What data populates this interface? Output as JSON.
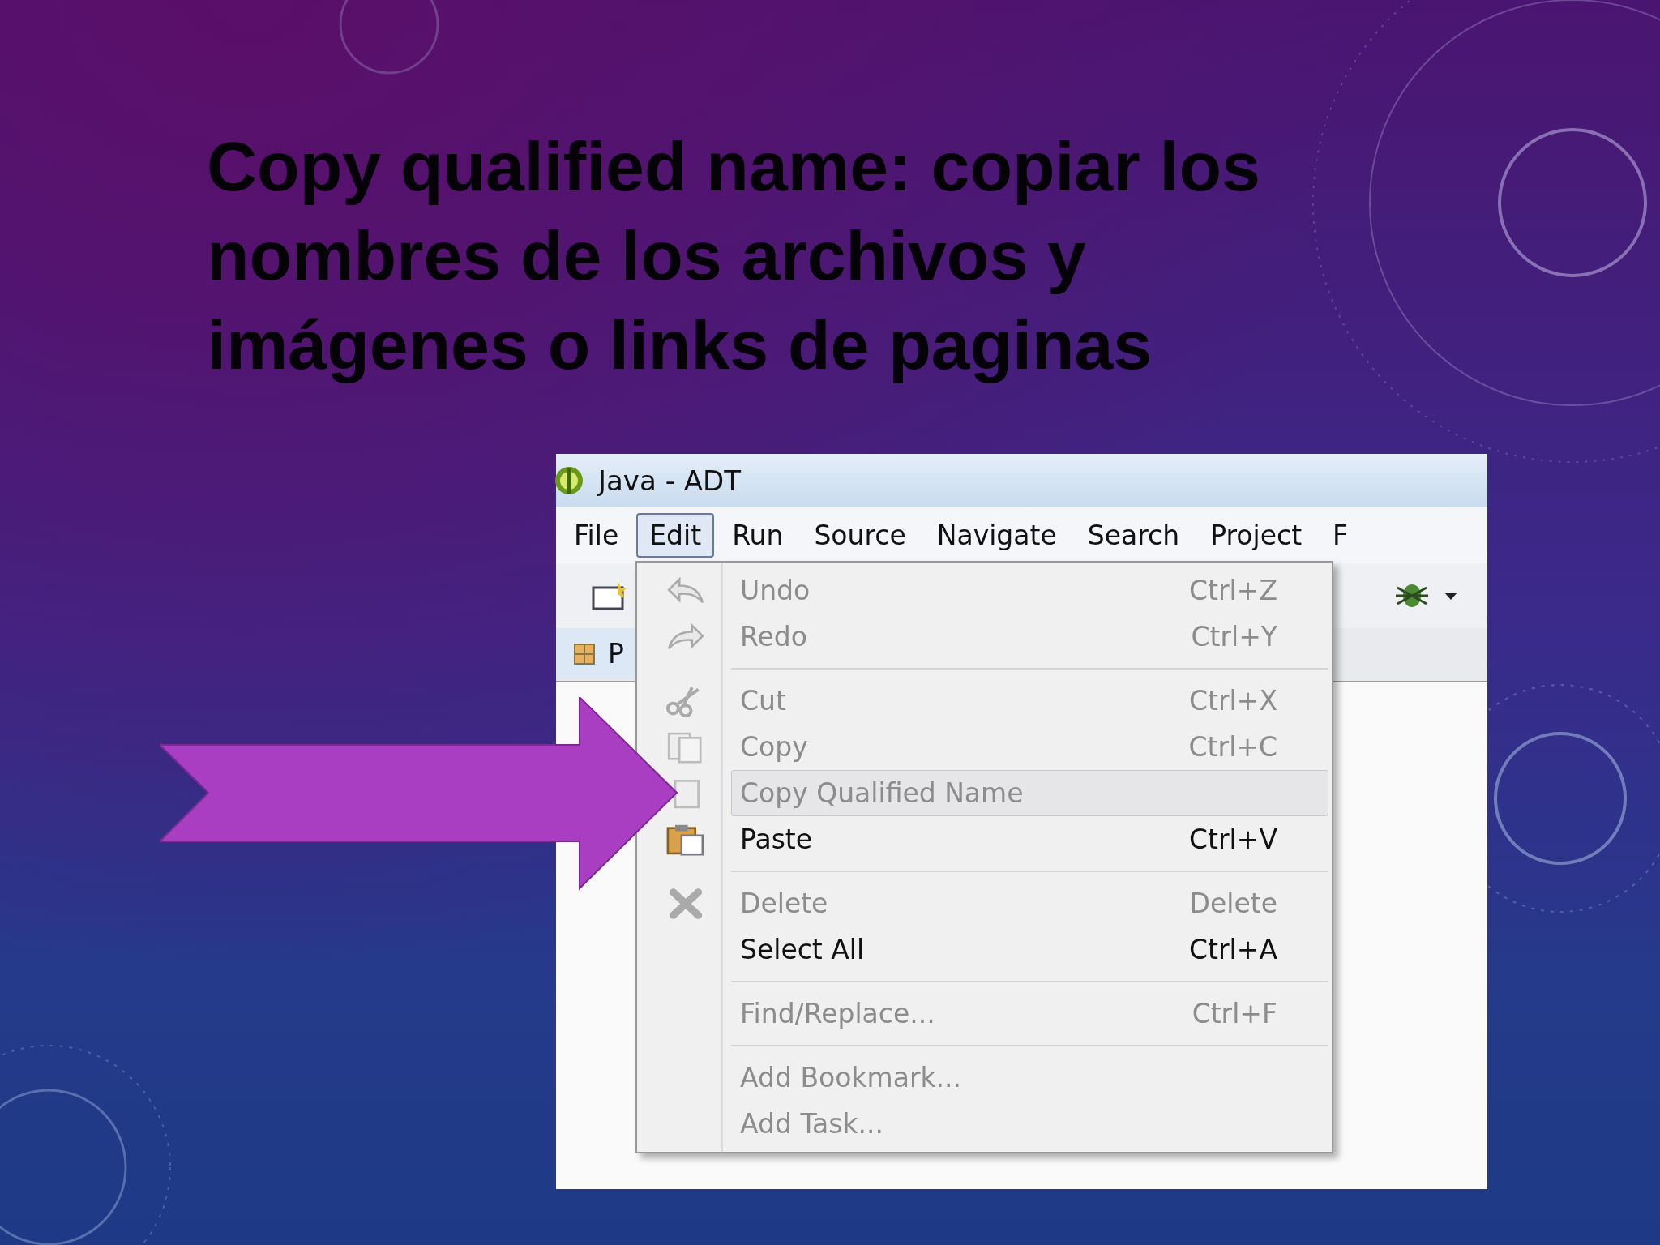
{
  "slide": {
    "title": "Copy qualified name: copiar los nombres de los archivos y imágenes o links de paginas"
  },
  "window": {
    "title": "Java - ADT"
  },
  "menubar": [
    {
      "label": "File",
      "selected": false
    },
    {
      "label": "Edit",
      "selected": true
    },
    {
      "label": "Run",
      "selected": false
    },
    {
      "label": "Source",
      "selected": false
    },
    {
      "label": "Navigate",
      "selected": false
    },
    {
      "label": "Search",
      "selected": false
    },
    {
      "label": "Project",
      "selected": false
    },
    {
      "label": "F",
      "selected": false
    }
  ],
  "tab": {
    "label": "P"
  },
  "menu": {
    "items": [
      {
        "kind": "item",
        "label": "Undo",
        "shortcut": "Ctrl+Z",
        "disabled": true,
        "selected": false
      },
      {
        "kind": "item",
        "label": "Redo",
        "shortcut": "Ctrl+Y",
        "disabled": true,
        "selected": false
      },
      {
        "kind": "separator"
      },
      {
        "kind": "item",
        "label": "Cut",
        "shortcut": "Ctrl+X",
        "disabled": true,
        "selected": false
      },
      {
        "kind": "item",
        "label": "Copy",
        "shortcut": "Ctrl+C",
        "disabled": true,
        "selected": false
      },
      {
        "kind": "item",
        "label": "Copy Qualified Name",
        "disabled": true,
        "selected": true
      },
      {
        "kind": "item",
        "label": "Paste",
        "shortcut": "Ctrl+V",
        "disabled": false,
        "selected": false
      },
      {
        "kind": "separator"
      },
      {
        "kind": "item",
        "label": "Delete",
        "shortcut": "Delete",
        "disabled": true,
        "selected": false
      },
      {
        "kind": "item",
        "label": "Select All",
        "shortcut": "Ctrl+A",
        "disabled": false,
        "selected": false
      },
      {
        "kind": "separator"
      },
      {
        "kind": "item",
        "label": "Find/Replace...",
        "shortcut": "Ctrl+F",
        "disabled": true,
        "selected": false
      },
      {
        "kind": "separator"
      },
      {
        "kind": "item",
        "label": "Add Bookmark...",
        "disabled": true,
        "selected": false
      },
      {
        "kind": "item",
        "label": "Add Task...",
        "disabled": true,
        "selected": false
      }
    ]
  }
}
